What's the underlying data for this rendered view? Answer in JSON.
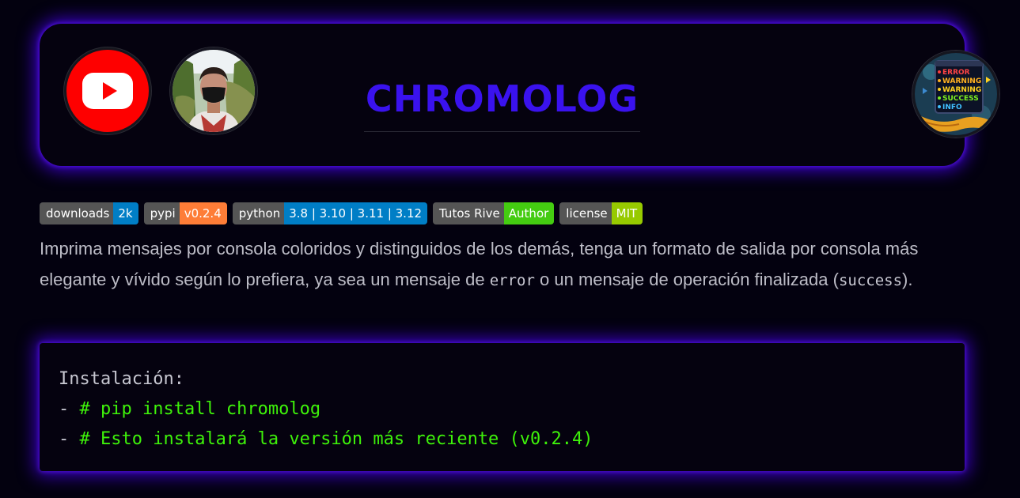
{
  "header": {
    "youtube_icon": "youtube-play-icon",
    "avatar_icon": "author-photo",
    "logo_icon": "chromolog-logo",
    "logo_lines": [
      "ERROR",
      "WARNING",
      "WARNING",
      "SUCCESS",
      "INFO"
    ],
    "title": "CHROMOLOG",
    "title_color": "#3a12ee",
    "glow_color": "#4b00ff"
  },
  "badges": [
    {
      "label": "downloads",
      "value": "2k",
      "color": "#007ec6"
    },
    {
      "label": "pypi",
      "value": "v0.2.4",
      "color": "#fe7d37"
    },
    {
      "label": "python",
      "value": "3.8 | 3.10 | 3.11 | 3.12",
      "color": "#007ec6"
    },
    {
      "label": "Tutos Rive",
      "value": "Author",
      "color": "#44cc11"
    },
    {
      "label": "license",
      "value": "MIT",
      "color": "#97ca00"
    }
  ],
  "description": {
    "part1": "Imprima mensajes por consola coloridos y distinguidos de los demás, tenga un formato de salida por consola más elegante y vívido según lo prefiera, ya sea un mensaje de ",
    "code1": "error",
    "part2": " o un mensaje de operación finalizada (",
    "code2": "success",
    "part3": ")."
  },
  "install": {
    "heading": "Instalación:",
    "lines": [
      {
        "dash": "- ",
        "text": "# pip install chromolog"
      },
      {
        "dash": "- ",
        "text": "# Esto instalará la versión más reciente (v0.2.4)"
      }
    ],
    "comment_color": "#3ef20a"
  }
}
